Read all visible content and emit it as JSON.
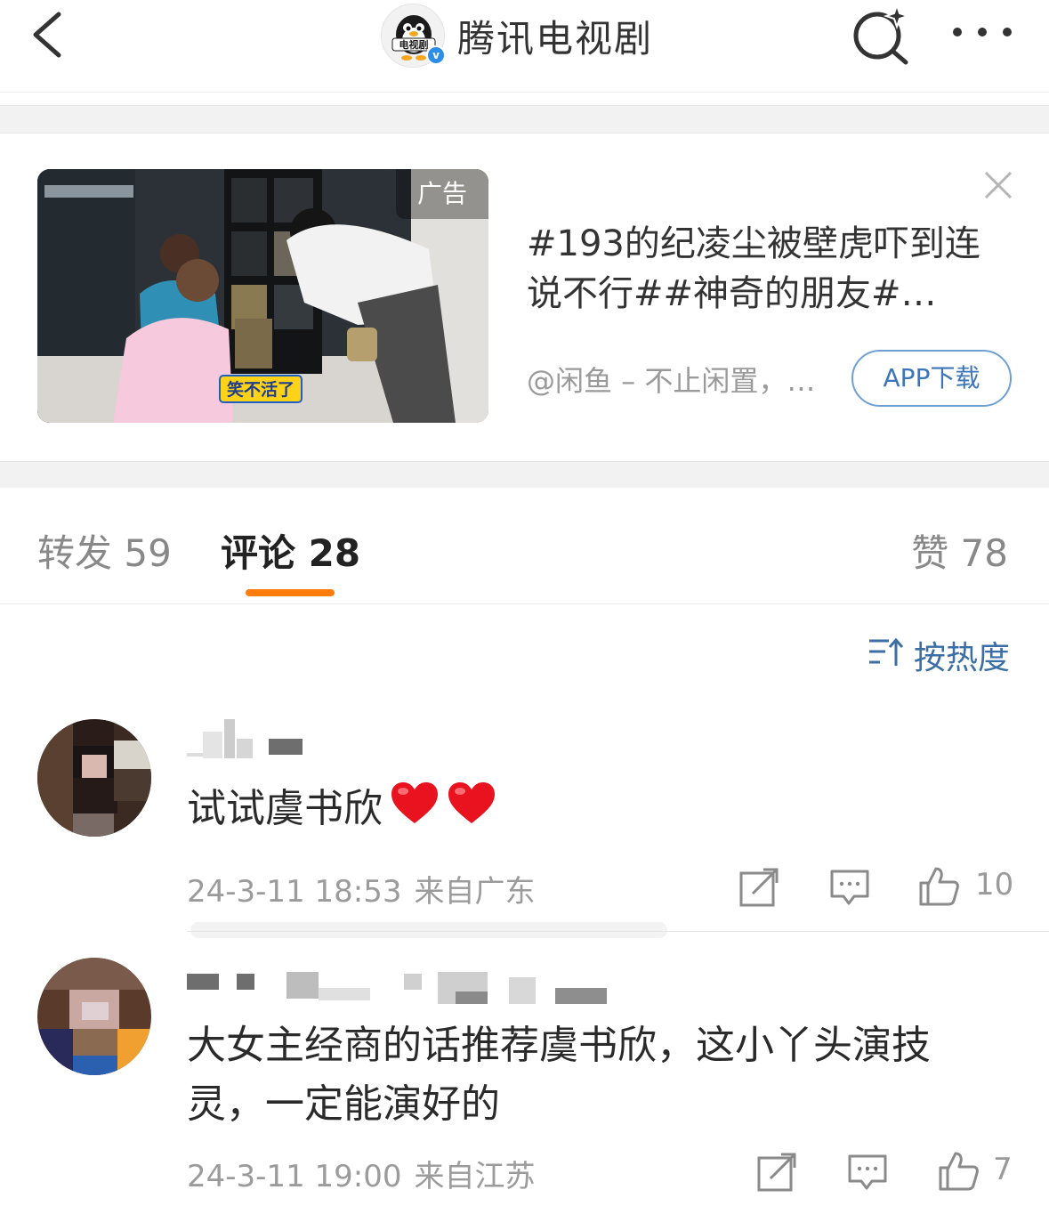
{
  "header": {
    "title": "腾讯电视剧",
    "avatar_text": "电视剧",
    "verified_mark": "v",
    "icons": {
      "back": "back-arrow-icon",
      "search": "search-sparkle-icon",
      "more": "more-dots-icon"
    }
  },
  "ad": {
    "tag": "广告",
    "caption": "笑不活了",
    "title": "#193的纪凌尘被壁虎吓到连说不行##神奇的朋友#…",
    "source": "@闲鱼 – 不止闲置，…",
    "download_label": "APP下载"
  },
  "tabs": {
    "repost": "转发 59",
    "comment": "评论 28",
    "like": "赞 78",
    "active": "comment",
    "accent": "#ff7c0d"
  },
  "sort": {
    "label": "按热度",
    "icon": "sort-icon"
  },
  "comments": [
    {
      "text": "试试虞书欣",
      "emoji": [
        "heart",
        "heart"
      ],
      "time": "24-3-11 18:53",
      "location": "来自广东",
      "likes": "10"
    },
    {
      "text": "大女主经商的话推荐虞书欣，这小丫头演技灵，一定能演好的",
      "time": "24-3-11 19:00",
      "location": "来自江苏",
      "likes": "7"
    }
  ],
  "colors": {
    "link": "#3c6ea6",
    "meta": "#9b9b9b",
    "heart": "#e8131f"
  }
}
